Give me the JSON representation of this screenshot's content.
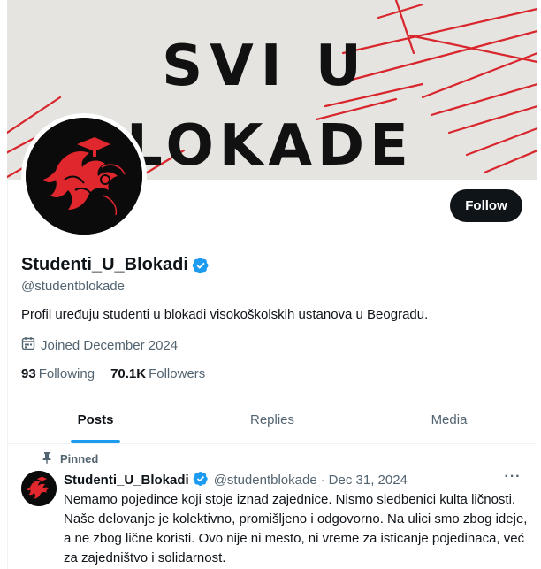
{
  "banner": {
    "line1": "SVI U",
    "line2": "BLOKADE"
  },
  "profile": {
    "display_name": "Studenti_U_Blokadi",
    "handle": "@studentblokade",
    "bio": "Profil uređuju studenti u blokadi visokoškolskih ustanova u Beogradu.",
    "joined": "Joined December 2024",
    "following_count": "93",
    "following_label": "Following",
    "followers_count": "70.1K",
    "followers_label": "Followers",
    "follow_label": "Follow"
  },
  "tabs": [
    {
      "label": "Posts",
      "active": true
    },
    {
      "label": "Replies",
      "active": false
    },
    {
      "label": "Media",
      "active": false
    }
  ],
  "pinned_tweet": {
    "pinned_label": "Pinned",
    "author_name": "Studenti_U_Blokadi",
    "author_handle": "@studentblokade",
    "separator": "·",
    "date": "Dec 31, 2024",
    "more_label": "···",
    "text": "Nemamo pojedince koji stoje iznad zajednice. Nismo sledbenici kulta ličnosti. Naše delovanje je kolektivno, promišljeno i odgovorno. Na ulici smo zbog ideje, a ne zbog lične koristi. Ovo nije ni mesto, ni vreme za isticanje pojedinaca, već za zajedništvo i solidarnost."
  },
  "colors": {
    "accent": "#1d9bf0",
    "text_primary": "#0f1419",
    "text_secondary": "#536471",
    "banner_red": "#d8262c",
    "avatar_red": "#e0272e"
  },
  "icons": {
    "verified": "verified-badge-icon",
    "calendar": "calendar-icon",
    "pin": "pin-icon",
    "more": "more-horizontal-icon"
  }
}
